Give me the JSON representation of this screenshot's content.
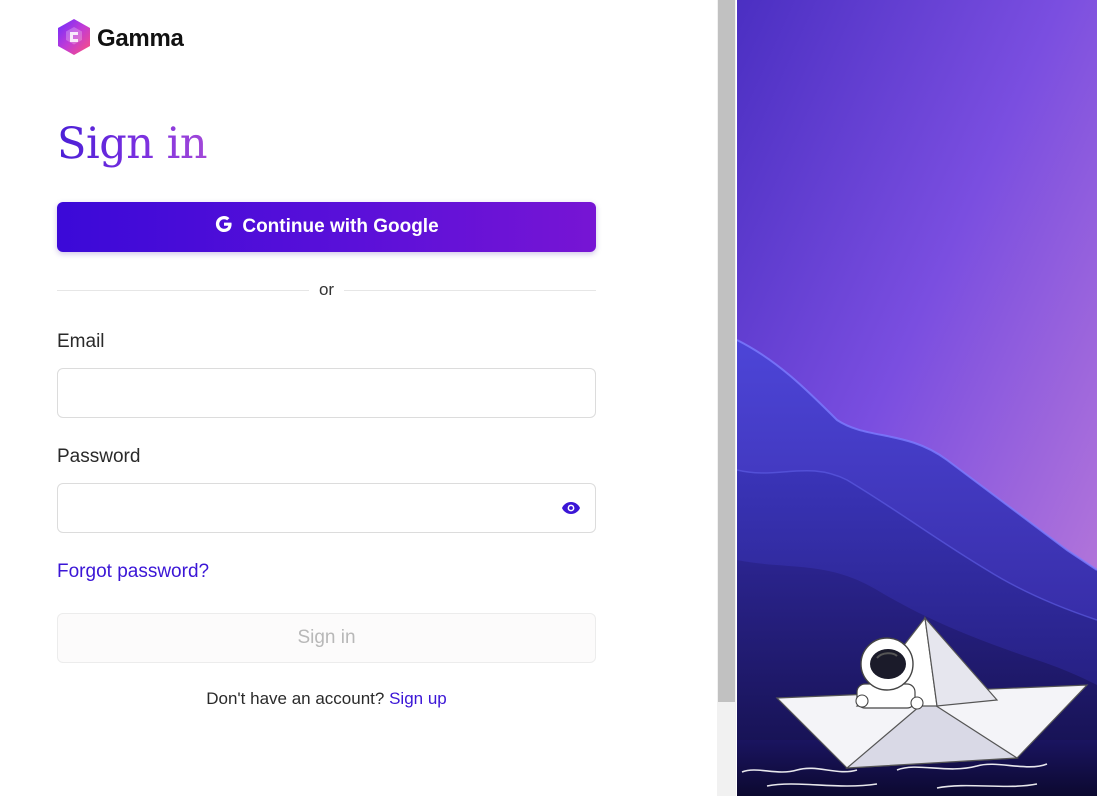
{
  "brand": {
    "name": "Gamma",
    "logo_icon": "gamma-logo-icon"
  },
  "title": "Sign in",
  "google_button": {
    "label": "Continue with Google",
    "icon": "google-g-icon"
  },
  "divider_text": "or",
  "email": {
    "label": "Email",
    "value": "",
    "placeholder": ""
  },
  "password": {
    "label": "Password",
    "value": "",
    "placeholder": "",
    "toggle_icon": "eye-icon"
  },
  "forgot_password": "Forgot password?",
  "signin_button": {
    "label": "Sign in",
    "disabled": true
  },
  "signup": {
    "prompt": "Don't have an account?",
    "link": "Sign up"
  },
  "colors": {
    "accent": "#3b16d6",
    "google_button_start": "#3b09d8",
    "google_button_end": "#7715d4"
  }
}
